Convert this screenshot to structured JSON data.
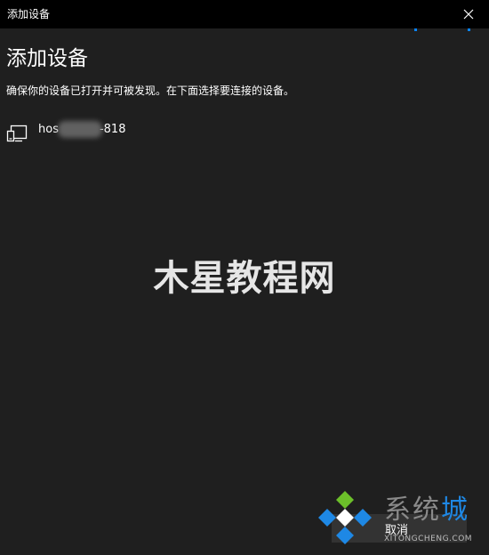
{
  "window": {
    "title": "添加设备",
    "close_icon": "close-icon"
  },
  "colors": {
    "background": "#1f1f1f",
    "titlebar": "#000000",
    "accent": "#0a84ff",
    "button": "#333333",
    "site_accent": "#1e88e5"
  },
  "page": {
    "heading": "添加设备",
    "instruction": "确保你的设备已打开并可被发现。在下面选择要连接的设备。"
  },
  "devices": [
    {
      "name_start": "hos",
      "name_end": "-818",
      "icon": "device-icon"
    }
  ],
  "watermark": {
    "text": "木星教程网"
  },
  "footer": {
    "cancel_label": "取消"
  },
  "site_watermark": {
    "name_gray": "系统",
    "name_accent": "城",
    "url": "XITONGCHENG.COM",
    "icon": "diamond-logo-icon"
  }
}
